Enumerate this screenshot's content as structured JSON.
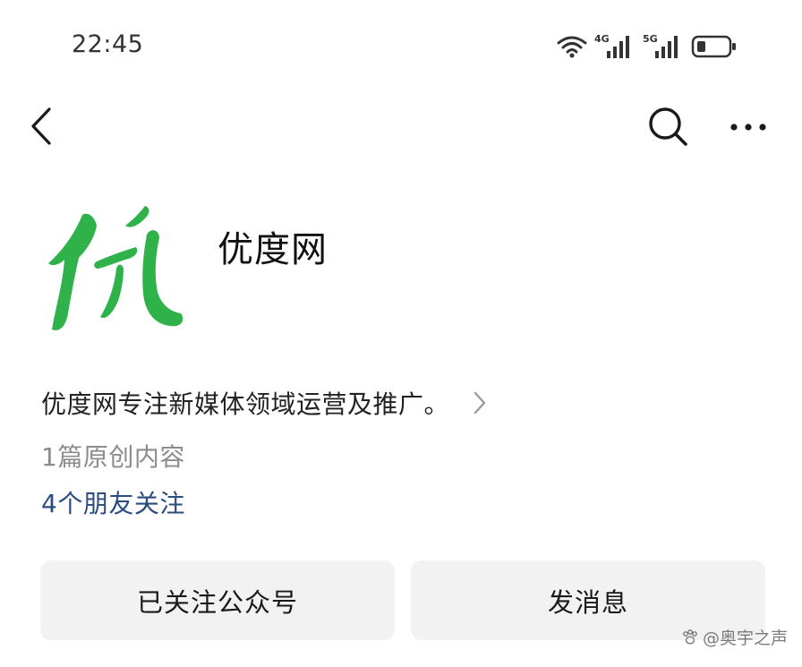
{
  "status_bar": {
    "time": "22:45",
    "network_1": "4G",
    "network_2": "5G",
    "icons": [
      "wifi-icon",
      "signal-4g-icon",
      "signal-5g-icon",
      "battery-icon"
    ]
  },
  "nav": {
    "back_icon": "chevron-left-icon",
    "search_icon": "search-icon",
    "more_icon": "more-icon"
  },
  "profile": {
    "avatar_glyph": "优",
    "name": "优度网",
    "description": "优度网专注新媒体领域运营及推广。",
    "original_count": "1篇原创内容",
    "friends_follow": "4个朋友关注"
  },
  "actions": {
    "followed_label": "已关注公众号",
    "message_label": "发消息"
  },
  "watermark": {
    "text": "@奥宇之声"
  },
  "colors": {
    "brand_green": "#2fb24a",
    "link_blue": "#2b4c7e",
    "button_bg": "#f2f2f2",
    "muted_text": "#8c8c8c"
  }
}
